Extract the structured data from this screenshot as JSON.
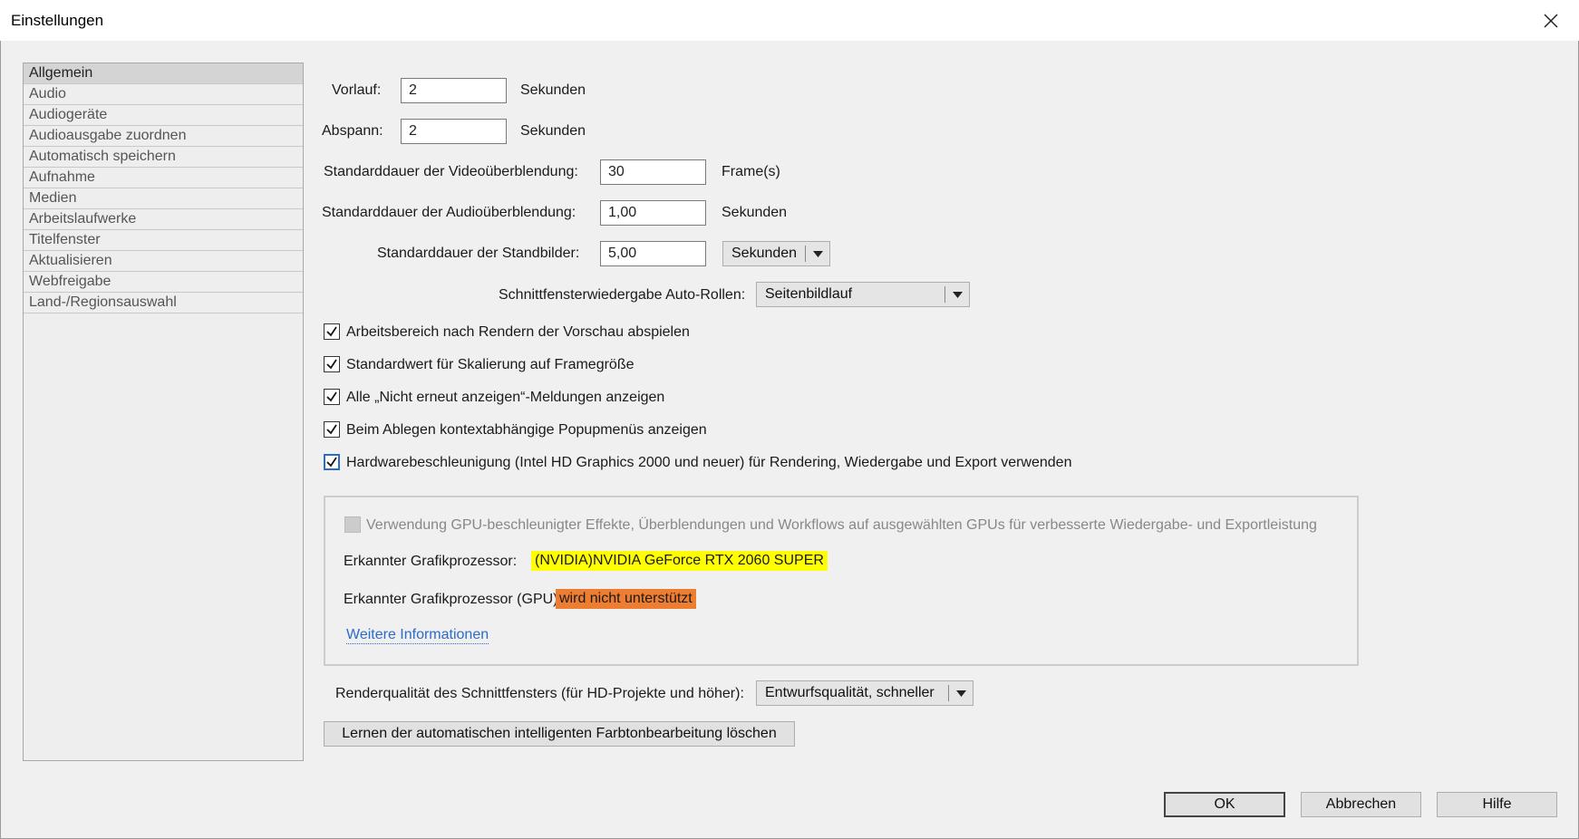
{
  "window": {
    "title": "Einstellungen"
  },
  "sidebar": {
    "items": [
      {
        "label": "Allgemein",
        "active": true
      },
      {
        "label": "Audio"
      },
      {
        "label": "Audiogeräte"
      },
      {
        "label": "Audioausgabe zuordnen"
      },
      {
        "label": "Automatisch speichern"
      },
      {
        "label": "Aufnahme"
      },
      {
        "label": "Medien"
      },
      {
        "label": "Arbeitslaufwerke"
      },
      {
        "label": "Titelfenster"
      },
      {
        "label": "Aktualisieren"
      },
      {
        "label": "Webfreigabe"
      },
      {
        "label": "Land-/Regionsauswahl"
      }
    ]
  },
  "general": {
    "preroll": {
      "label": "Vorlauf:",
      "value": "2",
      "unit": "Sekunden"
    },
    "postroll": {
      "label": "Abspann:",
      "value": "2",
      "unit": "Sekunden"
    },
    "video_transition": {
      "label": "Standarddauer der Videoüberblendung:",
      "value": "30",
      "unit": "Frame(s)"
    },
    "audio_transition": {
      "label": "Standarddauer der Audioüberblendung:",
      "value": "1,00",
      "unit": "Sekunden"
    },
    "still_image": {
      "label": "Standarddauer der Standbilder:",
      "value": "5,00",
      "unit_select": "Sekunden"
    },
    "autoscroll": {
      "label": "Schnittfensterwiedergabe Auto-Rollen:",
      "value": "Seitenbildlauf"
    },
    "checkboxes": [
      {
        "label": "Arbeitsbereich nach Rendern der Vorschau abspielen",
        "checked": true
      },
      {
        "label": "Standardwert für Skalierung auf Framegröße",
        "checked": true
      },
      {
        "label": "Alle „Nicht erneut anzeigen“-Meldungen anzeigen",
        "checked": true
      },
      {
        "label": "Beim Ablegen kontextabhängige Popupmenüs anzeigen",
        "checked": true
      },
      {
        "label": "Hardwarebeschleunigung (Intel HD Graphics 2000 und neuer) für Rendering, Wiedergabe und Export verwenden",
        "checked": true
      }
    ]
  },
  "gpu": {
    "checkbox_label": "Verwendung GPU-beschleunigter Effekte, Überblendungen und Workflows auf ausgewählten GPUs für verbesserte Wiedergabe- und Exportleistung",
    "detected_label": "Erkannter Grafikprozessor:",
    "detected_value": "(NVIDIA)NVIDIA GeForce RTX 2060 SUPER",
    "support_label": "Erkannter Grafikprozessor (GPU)",
    "support_value": "wird nicht unterstützt",
    "more_info": "Weitere Informationen",
    "highlight_yellow": "#ffff00",
    "highlight_orange": "#ed7d31"
  },
  "render_quality": {
    "label": "Renderqualität des Schnittfensters (für HD-Projekte und höher):",
    "value": "Entwurfsqualität, schneller"
  },
  "reset_button": "Lernen der automatischen intelligenten Farbtonbearbeitung löschen",
  "buttons": {
    "ok": "OK",
    "cancel": "Abbrechen",
    "help": "Hilfe"
  }
}
